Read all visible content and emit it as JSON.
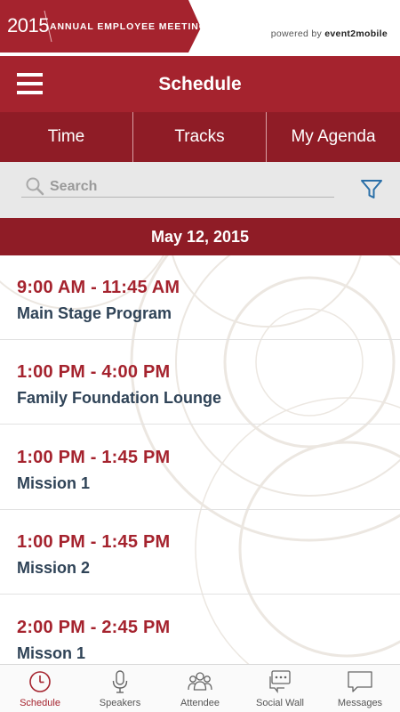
{
  "banner": {
    "year": "2015",
    "title": "ANNUAL EMPLOYEE MEETING",
    "powered_prefix": "powered by",
    "powered_brand": "event2mobile"
  },
  "header": {
    "title": "Schedule",
    "menu_icon": "hamburger-menu-icon"
  },
  "tabs": [
    {
      "label": "Time",
      "selected": true
    },
    {
      "label": "Tracks",
      "selected": false
    },
    {
      "label": "My Agenda",
      "selected": false
    }
  ],
  "search": {
    "placeholder": "Search",
    "filter_icon": "filter-icon"
  },
  "date": "May 12, 2015",
  "sessions": [
    {
      "time": "9:00 AM - 11:45 AM",
      "title": "Main Stage Program"
    },
    {
      "time": "1:00 PM - 4:00 PM",
      "title": "Family Foundation Lounge"
    },
    {
      "time": "1:00 PM - 1:45 PM",
      "title": "Mission 1"
    },
    {
      "time": "1:00 PM - 1:45 PM",
      "title": "Mission 2"
    },
    {
      "time": "2:00 PM - 2:45 PM",
      "title": "Misson 1"
    }
  ],
  "bottom_nav": [
    {
      "label": "Schedule",
      "icon": "clock-icon",
      "active": true
    },
    {
      "label": "Speakers",
      "icon": "microphone-icon",
      "active": false
    },
    {
      "label": "Attendee",
      "icon": "people-icon",
      "active": false
    },
    {
      "label": "Social Wall",
      "icon": "chat-bubble-icon",
      "active": false
    },
    {
      "label": "Messages",
      "icon": "message-icon",
      "active": false
    }
  ],
  "colors": {
    "brand_red": "#a5232e",
    "dark_red": "#8f1c26",
    "title_navy": "#2f4357",
    "search_bg": "#e8e8e8",
    "filter_blue": "#2a6fa8"
  }
}
